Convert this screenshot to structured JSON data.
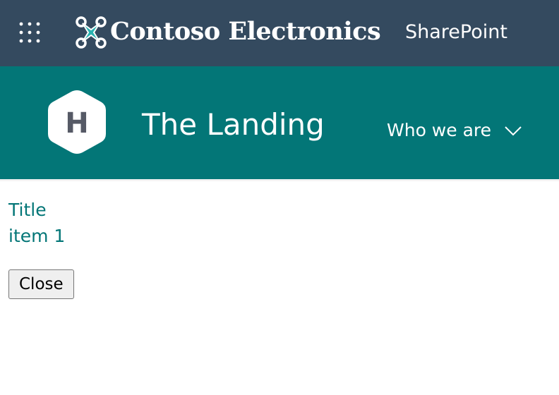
{
  "suitebar": {
    "app_launcher_icon": "waffle-grid-icon",
    "brand_logo_icon": "contoso-drone-logo-icon",
    "brand_name": "Contoso Electronics",
    "app_name": "SharePoint",
    "background": "#344a5f"
  },
  "site_header": {
    "logo_letter": "H",
    "title": "The Landing",
    "nav_items": [
      {
        "label": "Who we are",
        "icon": "chevron-down-icon"
      }
    ],
    "background": "#037677"
  },
  "content": {
    "lines": [
      "Title",
      "item 1"
    ],
    "close_label": "Close",
    "accent": "#037677"
  }
}
